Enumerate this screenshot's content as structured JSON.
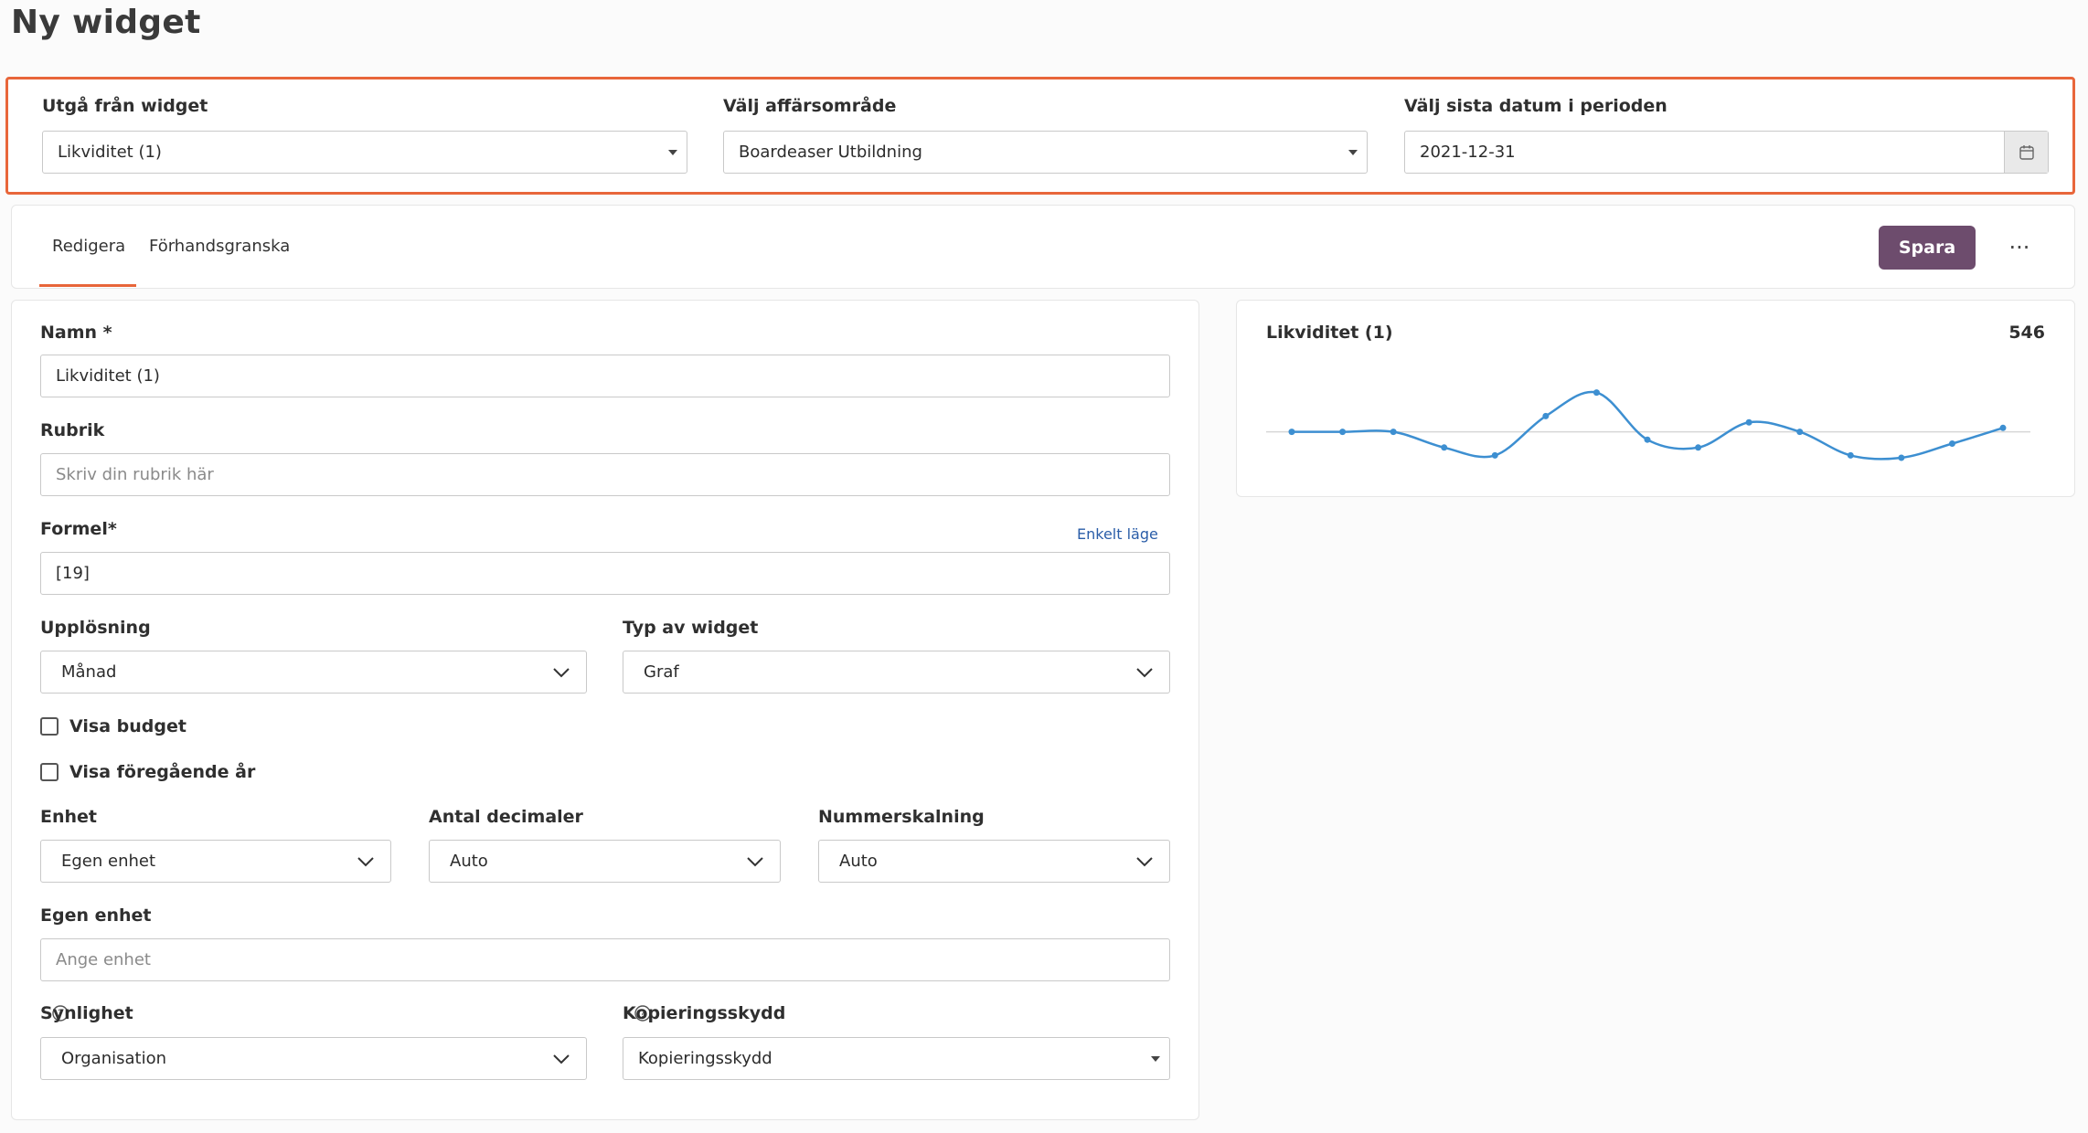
{
  "page": {
    "title": "Ny widget"
  },
  "filters": {
    "base_widget": {
      "label": "Utgå från widget",
      "value": "Likviditet (1)"
    },
    "business_area": {
      "label": "Välj affärsområde",
      "value": "Boardeaser Utbildning"
    },
    "period_end": {
      "label": "Välj sista datum i perioden",
      "value": "2021-12-31"
    }
  },
  "tabs": {
    "edit": "Redigera",
    "preview": "Förhandsgranska",
    "save_label": "Spara",
    "more_label": "···"
  },
  "form": {
    "name": {
      "label": "Namn *",
      "value": "Likviditet (1)"
    },
    "heading": {
      "label": "Rubrik",
      "placeholder": "Skriv din rubrik här"
    },
    "formula": {
      "label": "Formel*",
      "value": "[19]",
      "mode_link": "Enkelt läge"
    },
    "resolution": {
      "label": "Upplösning",
      "value": "Månad"
    },
    "widget_type": {
      "label": "Typ av widget",
      "value": "Graf"
    },
    "show_budget": {
      "label": "Visa budget",
      "checked": false
    },
    "show_prev_year": {
      "label": "Visa föregående år",
      "checked": false
    },
    "unit": {
      "label": "Enhet",
      "value": "Egen enhet"
    },
    "decimals": {
      "label": "Antal decimaler",
      "value": "Auto"
    },
    "number_scaling": {
      "label": "Nummerskalning",
      "value": "Auto"
    },
    "custom_unit": {
      "label": "Egen enhet",
      "placeholder": "Ange enhet"
    },
    "visibility": {
      "label": "Synlighet",
      "value": "Organisation"
    },
    "copy_protection": {
      "label": "Kopieringsskydd",
      "value": "Kopieringsskydd"
    }
  },
  "preview": {
    "title": "Likviditet (1)",
    "value": "546"
  },
  "colors": {
    "accent": "#e8663a",
    "primary_button": "#6d4c6d",
    "line": "#3d8fd1",
    "link": "#2a5da8"
  },
  "chart_data": {
    "type": "line",
    "title": "Likviditet (1)",
    "xlabel": "",
    "ylabel": "",
    "grid": false,
    "ylim": [
      -40,
      60
    ],
    "values": [
      0,
      0,
      0,
      -20,
      -30,
      20,
      50,
      -10,
      -20,
      12,
      0,
      -30,
      -33,
      -15,
      5
    ],
    "baseline": 0
  }
}
